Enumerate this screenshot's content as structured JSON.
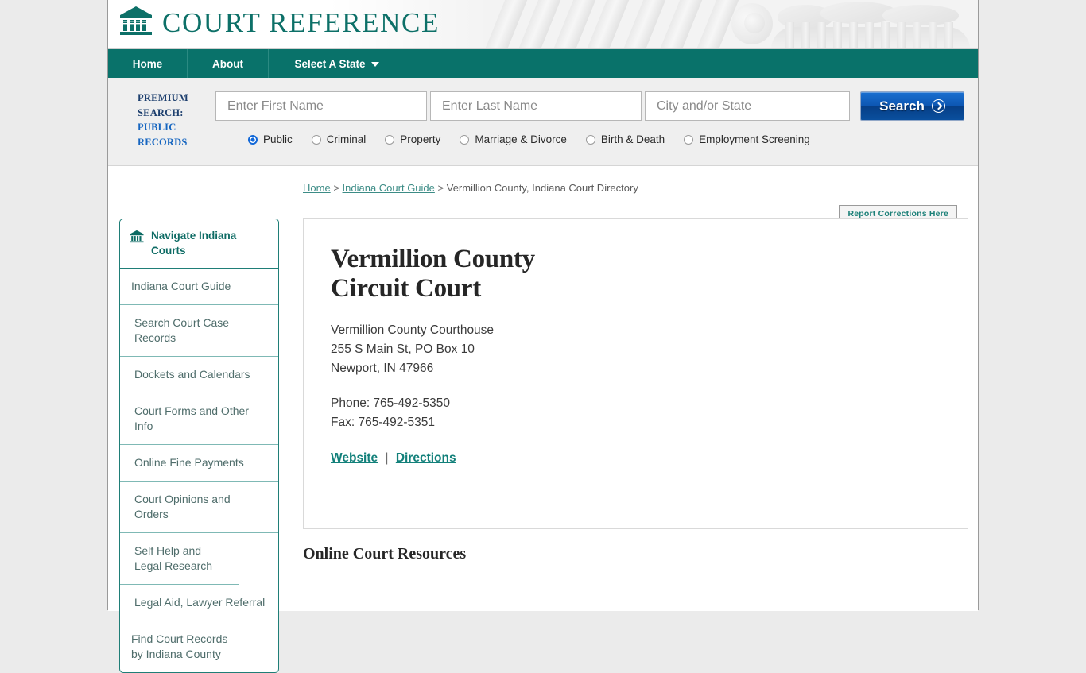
{
  "site": {
    "brand_name": "COURT REFERENCE",
    "logo_icon": "courthouse-icon",
    "accent_teal": "#09726a",
    "page_background": "#ebebeb"
  },
  "nav": {
    "items": [
      {
        "label": "Home",
        "name": "home"
      },
      {
        "label": "About",
        "name": "about"
      },
      {
        "label": "Select A State",
        "name": "select-a-state",
        "caret": "chevron-down-icon"
      }
    ]
  },
  "premium_search": {
    "label_line1": "PREMIUM",
    "label_line2": "SEARCH:",
    "label_line3": "PUBLIC",
    "label_line4": "RECORDS",
    "first_name": {
      "value": "",
      "placeholder": "Enter First Name"
    },
    "last_name": {
      "value": "",
      "placeholder": "Enter Last Name"
    },
    "city_state": {
      "value": "",
      "placeholder": "City and/or State"
    },
    "search_button": "Search",
    "search_button_icon": "chevron-right-circle-icon",
    "record_types": [
      {
        "label": "Public",
        "selected": true
      },
      {
        "label": "Criminal",
        "selected": false
      },
      {
        "label": "Property",
        "selected": false
      },
      {
        "label": "Marriage & Divorce",
        "selected": false
      },
      {
        "label": "Birth & Death",
        "selected": false
      },
      {
        "label": "Employment Screening",
        "selected": false
      }
    ]
  },
  "breadcrumb": {
    "home": "Home",
    "guide": "Indiana Court Guide",
    "current": "Vermillion County, Indiana Court Directory",
    "separator": ">"
  },
  "report_corrections": "Report Corrections Here",
  "sidebar": {
    "heading": "Navigate Indiana Courts",
    "heading_icon": "courthouse-icon",
    "items": [
      {
        "label": "Indiana Court Guide",
        "indent": false
      },
      {
        "label": "Search Court Case Records",
        "indent": true
      },
      {
        "label": "Dockets and Calendars",
        "indent": true
      },
      {
        "label": "Court Forms and Other Info",
        "indent": true
      },
      {
        "label": "Online Fine Payments",
        "indent": true
      },
      {
        "label": "Court Opinions and Orders",
        "indent": true
      },
      {
        "label": "Self Help and Legal Research",
        "indent": true
      },
      {
        "label": "Legal Aid, Lawyer Referral",
        "indent": true
      },
      {
        "label": "Find Court Records by Indiana County",
        "indent": false
      }
    ]
  },
  "court": {
    "title": "Vermillion County Circuit Court",
    "building": "Vermillion County Courthouse",
    "street": "255 S Main St, PO Box 10",
    "city_state_zip": "Newport, IN 47966",
    "phone": "Phone: 765-492-5350",
    "fax": "Fax: 765-492-5351",
    "website_link": "Website",
    "directions_link": "Directions",
    "link_separator": "|"
  },
  "resources": {
    "heading": "Online Court Resources"
  }
}
